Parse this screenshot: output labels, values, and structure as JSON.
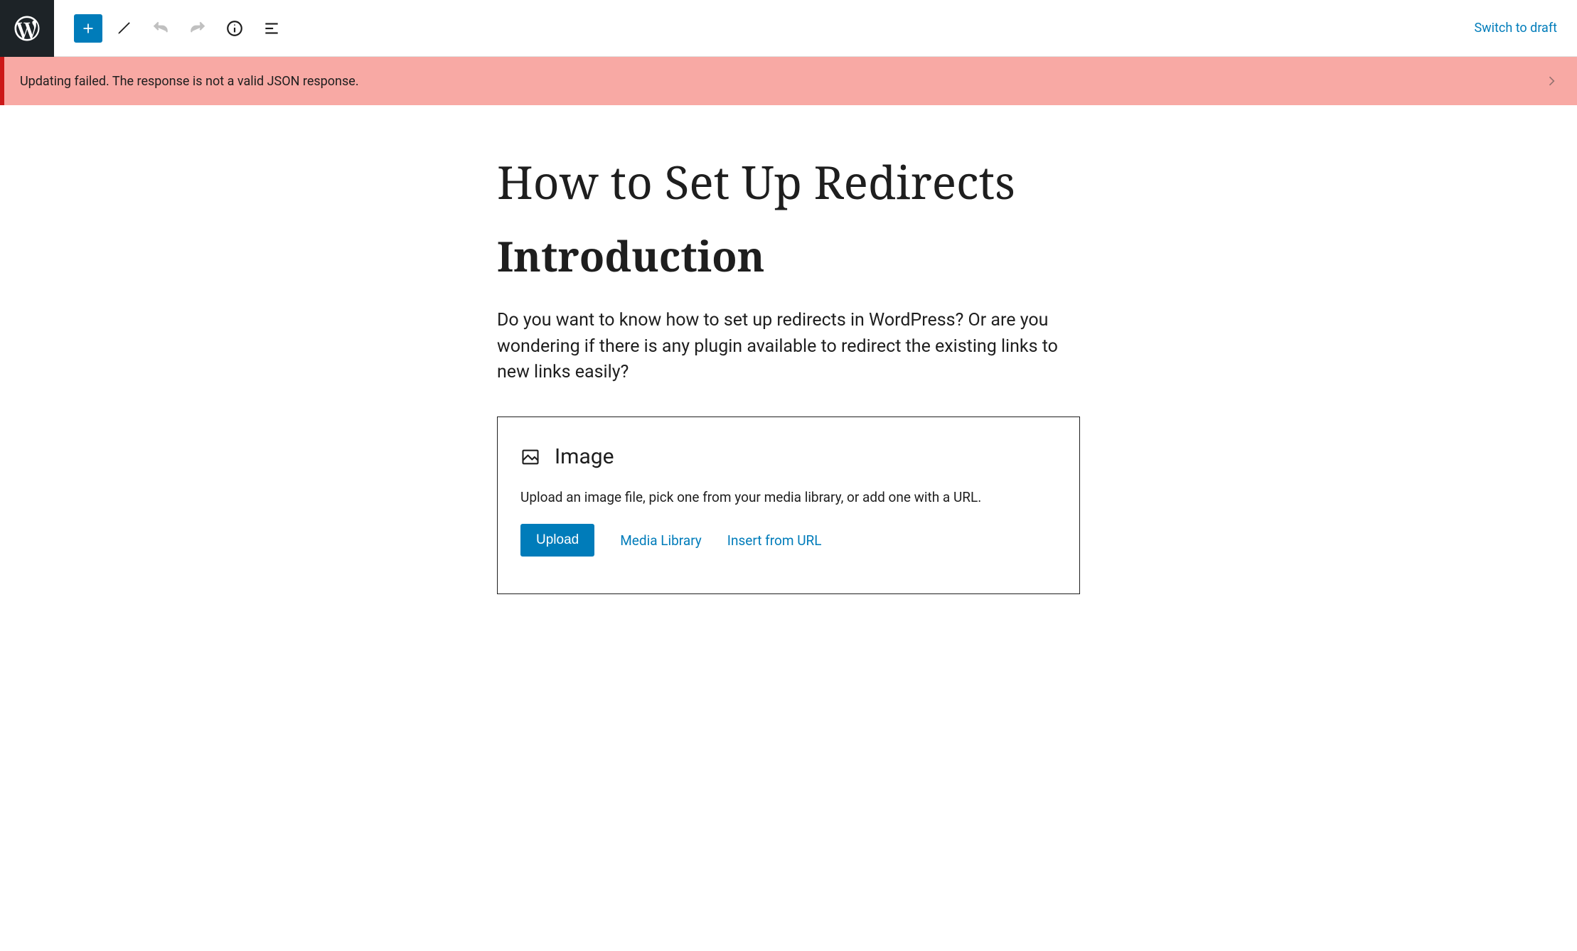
{
  "header": {
    "switch_to_draft_label": "Switch to draft"
  },
  "error": {
    "message": "Updating failed. The response is not a valid JSON response."
  },
  "post": {
    "title": "How to Set Up Redirects",
    "heading": "Introduction",
    "paragraph": "Do you want to know how to set up redirects in WordPress?  Or are you wondering if there is any plugin available to redirect the existing links to new links easily?"
  },
  "image_block": {
    "title": "Image",
    "description": "Upload an image file, pick one from your media library, or add one with a URL.",
    "upload_label": "Upload",
    "media_library_label": "Media Library",
    "insert_from_url_label": "Insert from URL"
  }
}
